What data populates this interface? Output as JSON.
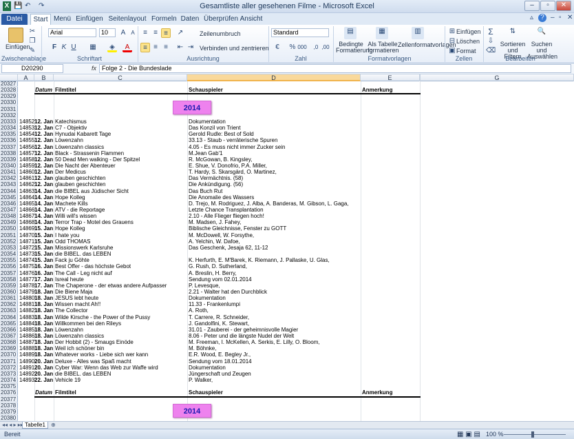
{
  "window": {
    "title": "Gesamtliste aller gesehenen Filme - Microsoft Excel"
  },
  "qat": {
    "undo": "↶",
    "redo": "↷",
    "save": "💾"
  },
  "tabs": [
    "Datei",
    "Start",
    "Menü",
    "Einfügen",
    "Seitenlayout",
    "Formeln",
    "Daten",
    "Überprüfen",
    "Ansicht"
  ],
  "ribbon": {
    "paste": "Einfügen",
    "clipboard": "Zwischenablage",
    "font_name": "Arial",
    "font_size": "10",
    "font_group": "Schriftart",
    "wrap": "Zeilenumbruch",
    "merge": "Verbinden und zentrieren",
    "align_group": "Ausrichtung",
    "num_format": "Standard",
    "num_group": "Zahl",
    "cond": "Bedingte Formatierung",
    "as_table": "Als Tabelle formatieren",
    "cell_styles": "Zellenformatvorlagen",
    "styles_group": "Formatvorlagen",
    "insert": "Einfügen",
    "delete": "Löschen",
    "format": "Format",
    "cells_group": "Zellen",
    "sort": "Sortieren und Filtern",
    "find": "Suchen und Auswählen",
    "edit_group": "Bearbeiten"
  },
  "formula": {
    "namebox": "D20290",
    "fx": "fx",
    "value": "Folge 2 - Die Bundeslade"
  },
  "columns": [
    "A",
    "B",
    "C",
    "D",
    "E",
    "F",
    "G"
  ],
  "header": {
    "b": "Datum",
    "c": "Filmtitel",
    "d": "Schauspieler",
    "e": "Anmerkung"
  },
  "year": "2014",
  "rownums": [
    "20327",
    "20328",
    "20329",
    "20330",
    "20331",
    "20332",
    "20333",
    "20334",
    "20335",
    "20336",
    "20337",
    "20338",
    "20339",
    "20340",
    "20341",
    "20342",
    "20343",
    "20344",
    "20345",
    "20346",
    "20347",
    "20348",
    "20349",
    "20350",
    "20351",
    "20352",
    "20353",
    "20354",
    "20355",
    "20356",
    "20357",
    "20358",
    "20359",
    "20360",
    "20361",
    "20362",
    "20363",
    "20364",
    "20365",
    "20366",
    "20367",
    "20368",
    "20369",
    "20370",
    "20371",
    "20372",
    "20373",
    "20374",
    "20375",
    "20376",
    "20377",
    "20378",
    "20379",
    "20380"
  ],
  "rows": [
    [
      "14852",
      "12. Jan",
      "Katechismus",
      "Dokumentation"
    ],
    [
      "14853",
      "12. Jan",
      "C7 - Objektiv",
      "Das Konzil von Trient"
    ],
    [
      "14854",
      "12. Jan",
      "Hynudai Kabarett Tage",
      "Gerold Rudle: Best of Sold"
    ],
    [
      "14855",
      "12. Jan",
      "Löwenzahn",
      "33.13 - Staub - verräterische Spuren"
    ],
    [
      "14856",
      "12. Jan",
      "Löwenzahn classics",
      "4.05 - Es muss nicht immer Zucker sein"
    ],
    [
      "14857",
      "12. Jan",
      "Black - Strassenin Flammen",
      "M.Jean Gab'1"
    ],
    [
      "14858",
      "12. Jan",
      "50 Dead Men walking - Der Spitzel",
      "R. McGowan, B. Kingsley,"
    ],
    [
      "14859",
      "12. Jan",
      "Die Nacht der Abenteuer",
      "E. Shue, V. Donofrio, P.A. Miller,"
    ],
    [
      "14860",
      "12. Jan",
      "Der Medicus",
      "T. Hardy, S. Skarsgård, O. Martinez,"
    ],
    [
      "14861",
      "12. Jan",
      "glauben geschichten",
      "Das Vermächtnis. (58)"
    ],
    [
      "14862",
      "12. Jan",
      "glauben geschichten",
      "Die Ankündigung. (56)"
    ],
    [
      "14863",
      "14. Jan",
      "die BIBEL aus Jüdischer Sicht",
      "Das Buch Rut"
    ],
    [
      "14864",
      "14. Jan",
      "Hope Kolleg",
      "Die Anomalie des Wassers"
    ],
    [
      "14865",
      "14. Jan",
      "Machete Kills",
      "D. Trejo, M. Rodriguez, J. Alba, A. Banderas, M. Gibson, L. Gaga,"
    ],
    [
      "14866",
      "14. Jan",
      "ATV - die Reportage",
      "Letzte Chance Transplantation"
    ],
    [
      "14867",
      "14. Jan",
      "Willi will's wissen",
      "2.10 - Alle Flieger fliegen hoch!"
    ],
    [
      "14868",
      "14. Jan",
      "Terror Trap - Motel des Grauens",
      "M. Madsen, J. Fahey,"
    ],
    [
      "14869",
      "15. Jan",
      "Hope Kolleg",
      "Biblische Gleichnisse, Fenster zu GOTT"
    ],
    [
      "14870",
      "15. Jan",
      "I hate you",
      "M. McDowell, W. Forsythe,"
    ],
    [
      "14871",
      "15. Jan",
      "Odd THOMAS",
      "A. Yelchin, W. Dafoe,"
    ],
    [
      "14872",
      "15. Jan",
      "Missionswerk Karlsruhe",
      "Das Geschenk, Jesaja 62, 11-12"
    ],
    [
      "14873",
      "15. Jan",
      "die BIBEL. das LEBEN",
      ""
    ],
    [
      "14874",
      "15. Jan",
      "Fack ju Göhte",
      "K. Herfurth, E. M'Barek, K. Riemann, J. Pallaske, U. Glas,"
    ],
    [
      "14875",
      "16. Jan",
      "Best Offer - das höchste Gebot",
      "G. Rush, D. Sutherland,"
    ],
    [
      "14876",
      "16. Jan",
      "The Call - Leg nicht auf",
      "A. Breslin, H. Berry,"
    ],
    [
      "14877",
      "17. Jan",
      "Isreal heute",
      "Sendung vom 02.01.2014"
    ],
    [
      "14878",
      "17. Jan",
      "The Chaperone - der etwas andere Aufpasser",
      "P. Levesque,"
    ],
    [
      "14879",
      "18. Jan",
      "Die Biene Maja",
      "2.21 - Walter hat den Durchblick"
    ],
    [
      "14880",
      "18. Jan",
      "JESUS lebt heute",
      "Dokumentation"
    ],
    [
      "14881",
      "18. Jan",
      "Wissen macht Ah!!",
      "11.33 - Frankenlumpi"
    ],
    [
      "14882",
      "18. Jan",
      "The Collector",
      "A. Roth,"
    ],
    [
      "14883",
      "18. Jan",
      "Wilde Kirsche - the Power of the Pussy",
      "T. Carrere, R. Schneider,"
    ],
    [
      "14884",
      "18. Jan",
      "Willkommen bei den Rileys",
      "J. Gandolfini, K. Stewart,"
    ],
    [
      "14885",
      "18. Jan",
      "Löwenzahn",
      "31.01 - Zauberei - der geheimnisvolle Magier"
    ],
    [
      "14886",
      "18. Jan",
      "Löwenzahn classics",
      "8.06 - Peter und die längste Nudel der Welt"
    ],
    [
      "14887",
      "18. Jan",
      "Der Hobbit (2) - Smaugs Einöde",
      "M. Freeman, I. McKellen, A. Serkis, E. Lilly, O. Bloom,"
    ],
    [
      "14888",
      "18. Jan",
      "Weil ich schöner bin",
      "M. Böhnke,"
    ],
    [
      "14889",
      "18. Jan",
      "Whatever works - Liebe sich wer kann",
      "E.R. Wood, E. Begley Jr.,"
    ],
    [
      "14890",
      "20. Jan",
      "Deluxe - Alles was Spaß macht",
      "Sendung vom 18.01.2014"
    ],
    [
      "14891",
      "20. Jan",
      "Cyber War: Wenn das Web zur Waffe wird",
      "Dokumentation"
    ],
    [
      "14892",
      "20. Jan",
      "die BIBEL. das LEBEN",
      "Jüngerschaft und Zeugen"
    ],
    [
      "14893",
      "22. Jan",
      "Vehicle 19",
      "P. Walker,"
    ]
  ],
  "sheet_tab": "Tabelle1",
  "status": "Bereit",
  "zoom": "100 %"
}
